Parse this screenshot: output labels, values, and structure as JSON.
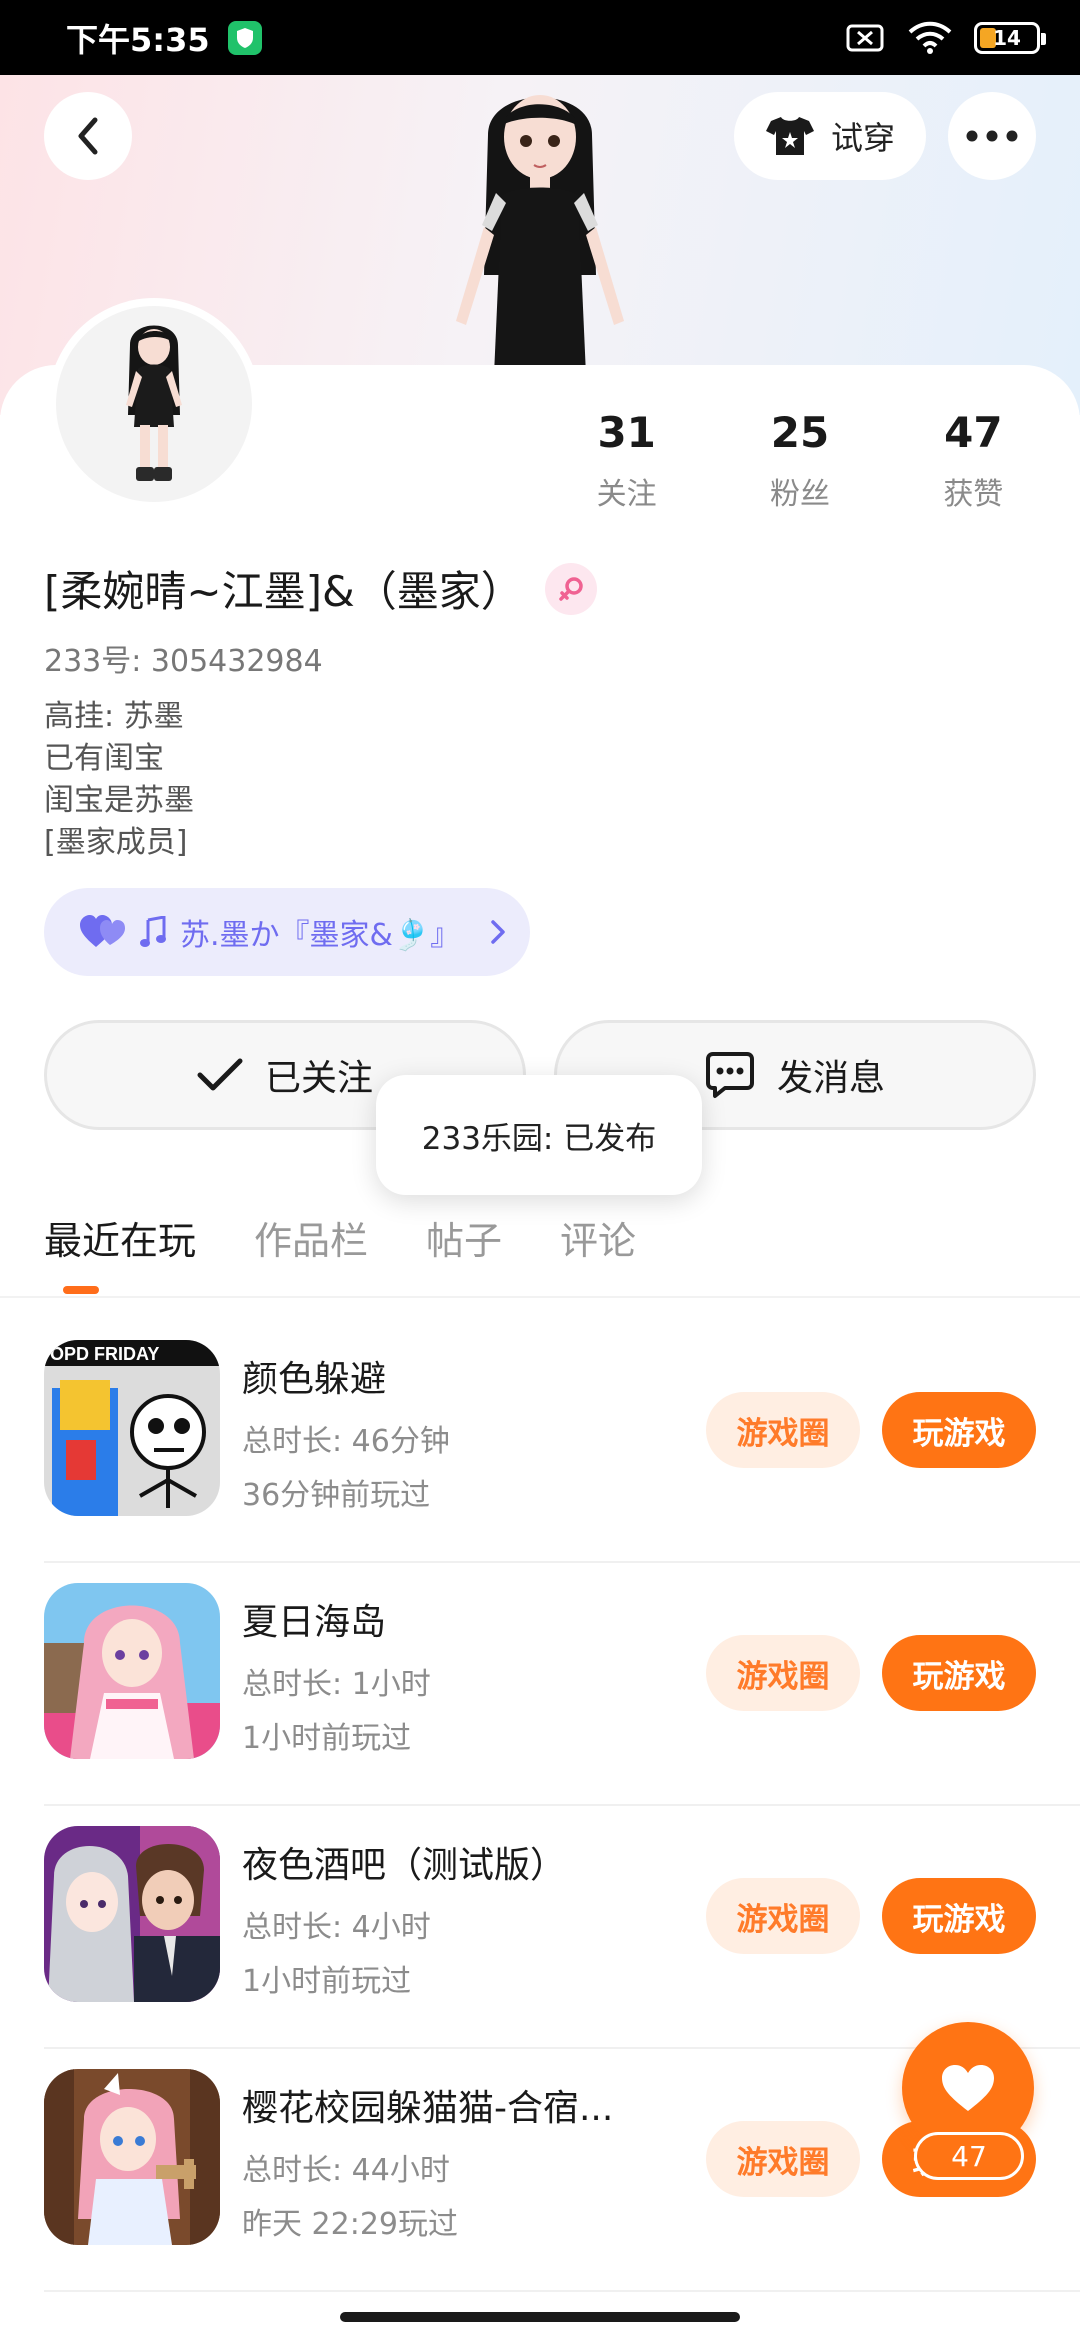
{
  "status_bar": {
    "time": "下午5:35",
    "battery": "14"
  },
  "header": {
    "tryon_label": "试穿"
  },
  "profile": {
    "stats": [
      {
        "num": "31",
        "label": "关注"
      },
      {
        "num": "25",
        "label": "粉丝"
      },
      {
        "num": "47",
        "label": "获赞"
      }
    ],
    "name": "[柔婉晴~江墨]&（墨家）",
    "uid": "233号: 305432984",
    "bio": [
      "高挂: 苏墨",
      "已有闺宝",
      "闺宝是苏墨",
      "[墨家成员]"
    ],
    "music_text": "苏.墨か『墨家&🎐』"
  },
  "actions": {
    "follow_label": "已关注",
    "message_label": "发消息"
  },
  "toast": {
    "text": "233乐园: 已发布"
  },
  "tabs": [
    {
      "label": "最近在玩"
    },
    {
      "label": "作品栏"
    },
    {
      "label": "帖子"
    },
    {
      "label": "评论"
    }
  ],
  "games": [
    {
      "title": "颜色躲避",
      "duration": "总时长: 46分钟",
      "last_played": "36分钟前玩过",
      "circle_label": "游戏圈",
      "play_label": "玩游戏"
    },
    {
      "title": "夏日海岛",
      "duration": "总时长: 1小时",
      "last_played": "1小时前玩过",
      "circle_label": "游戏圈",
      "play_label": "玩游戏"
    },
    {
      "title": "夜色酒吧（测试版）",
      "duration": "总时长: 4小时",
      "last_played": "1小时前玩过",
      "circle_label": "游戏圈",
      "play_label": "玩游戏"
    },
    {
      "title": "樱花校园躲猫猫-合宿...",
      "duration": "总时长: 44小时",
      "last_played": "昨天 22:29玩过",
      "circle_label": "游戏圈",
      "play_label": "玩游戏"
    }
  ],
  "game_icon_art": {
    "game1_banner": "OPD FRIDAY"
  },
  "like": {
    "count": "47"
  },
  "colors": {
    "accent": "#ff7414",
    "accent_soft": "#ffeee2",
    "music_pill_bg": "#ececfc",
    "music_pill_text": "#6f6cf0"
  }
}
